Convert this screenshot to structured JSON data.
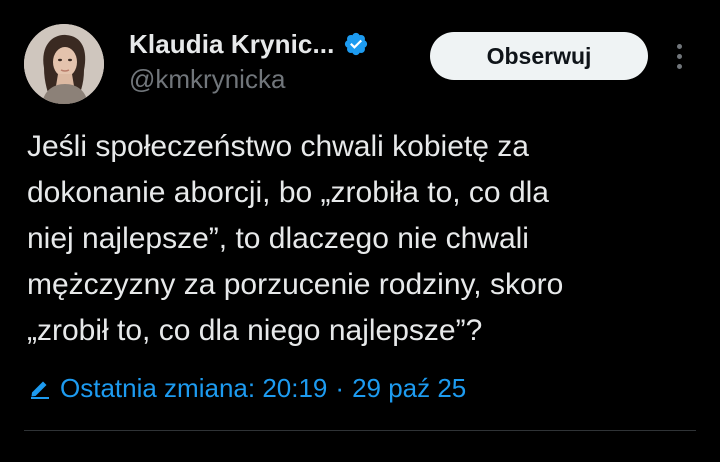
{
  "author": {
    "display_name": "Klaudia Krynic...",
    "handle": "@kmkrynicka",
    "verified": true
  },
  "actions": {
    "follow_label": "Obserwuj"
  },
  "tweet": {
    "lines": [
      "Jeśli społeczeństwo chwali kobietę za",
      "dokonanie aborcji, bo „zrobiła to, co dla",
      "niej najlepsze”, to dlaczego nie chwali",
      "mężczyzny za porzucenie rodziny, skoro",
      "„zrobił to, co dla niego najlepsze”?"
    ]
  },
  "edit_info": {
    "label": "Ostatnia zmiana: 20:19",
    "separator": "·",
    "date": "29 paź 25"
  },
  "colors": {
    "background": "#000000",
    "text": "#e7e9ea",
    "secondary": "#71767b",
    "accent": "#1d9bf0",
    "button_bg": "#eff3f4"
  },
  "icons": {
    "verified": "verified-badge-icon",
    "more": "more-options-icon",
    "edit": "pencil-icon"
  }
}
